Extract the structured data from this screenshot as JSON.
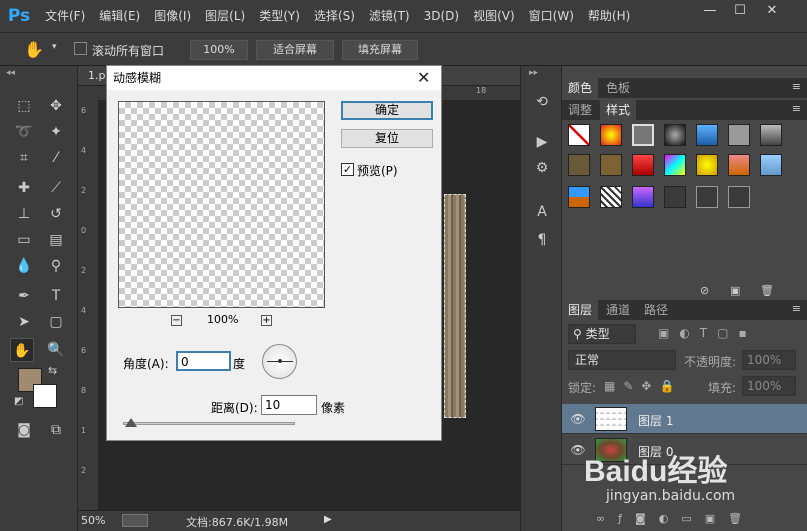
{
  "app": {
    "logo": "Ps"
  },
  "menu": [
    "文件(F)",
    "编辑(E)",
    "图像(I)",
    "图层(L)",
    "类型(Y)",
    "选择(S)",
    "滤镜(T)",
    "3D(D)",
    "视图(V)",
    "窗口(W)",
    "帮助(H)"
  ],
  "window_controls": {
    "minimize": "—",
    "maximize": "☐",
    "close": "✕"
  },
  "options": {
    "scroll_all_label": "滚动所有窗口",
    "zoom_100": "100%",
    "fit_screen": "适合屏幕",
    "fill_screen": "填充屏幕"
  },
  "document": {
    "tab_title": "1.p",
    "ruler_marks": [
      "18"
    ],
    "left_ruler": [
      "6",
      "4",
      "2",
      "0",
      "2",
      "4",
      "6",
      "8",
      "1",
      "2"
    ]
  },
  "status": {
    "zoom": "50%",
    "doc_info": "文档:867.6K/1.98M"
  },
  "dialog": {
    "title": "动感模糊",
    "ok": "确定",
    "reset": "复位",
    "preview_label": "预览(P)",
    "preview_checked": true,
    "zoom": "100%",
    "zoom_minus": "−",
    "zoom_plus": "+",
    "angle_label": "角度(A):",
    "angle_value": "0",
    "angle_unit": "度",
    "distance_label": "距离(D):",
    "distance_value": "10",
    "distance_unit": "像素"
  },
  "panels": {
    "color_tabs": [
      "颜色",
      "色板"
    ],
    "style_tabs": [
      "调整",
      "样式"
    ],
    "layer_tabs": [
      "图层",
      "通道",
      "路径"
    ],
    "filter_kind": "类型",
    "blend_mode": "正常",
    "opacity_label": "不透明度:",
    "opacity_value": "100%",
    "lock_label": "锁定:",
    "fill_label": "填充:",
    "fill_value": "100%",
    "layers": [
      {
        "name": "图层 1",
        "selected": true
      },
      {
        "name": "图层 0",
        "selected": false
      }
    ]
  },
  "watermark": {
    "brand": "Baidu经验",
    "url": "jingyan.baidu.com"
  },
  "colors": {
    "foreground": "#a08a72",
    "background": "#ffffff",
    "accent": "#31a8ff"
  }
}
